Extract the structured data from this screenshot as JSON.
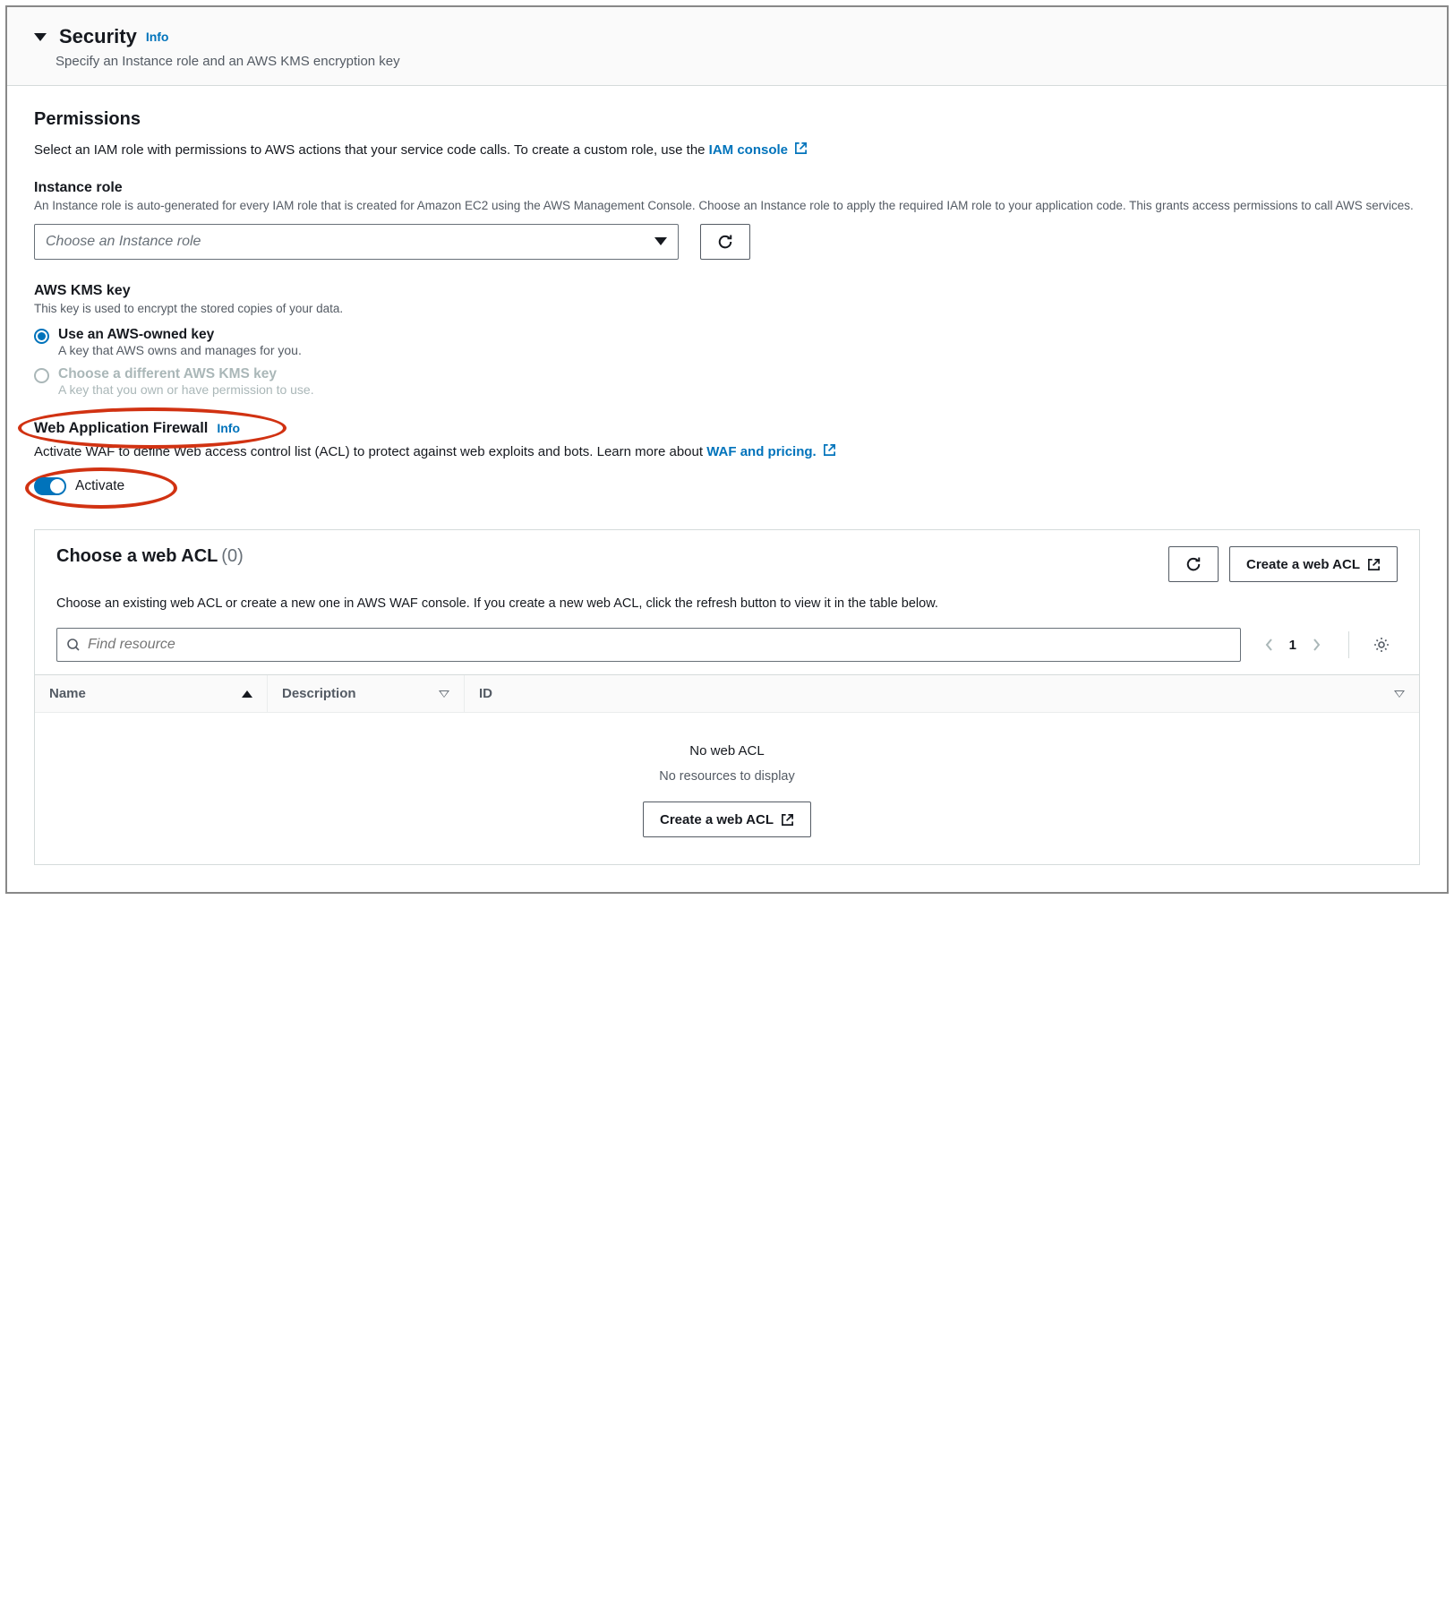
{
  "header": {
    "title": "Security",
    "info": "Info",
    "desc": "Specify an Instance role and an AWS KMS encryption key"
  },
  "permissions": {
    "title": "Permissions",
    "desc": "Select an IAM role with permissions to AWS actions that your service code calls. To create a custom role, use the ",
    "link": "IAM console"
  },
  "instanceRole": {
    "label": "Instance role",
    "help": "An Instance role is auto-generated for every IAM role that is created for Amazon EC2 using the AWS Management Console. Choose an Instance role to apply the required IAM role to your application code. This grants access permissions to call AWS services.",
    "placeholder": "Choose an Instance role"
  },
  "kms": {
    "label": "AWS KMS key",
    "help": "This key is used to encrypt the stored copies of your data.",
    "opt1": {
      "label": "Use an AWS-owned key",
      "sub": "A key that AWS owns and manages for you."
    },
    "opt2": {
      "label": "Choose a different AWS KMS key",
      "sub": "A key that you own or have permission to use."
    }
  },
  "waf": {
    "title": "Web Application Firewall",
    "info": "Info",
    "desc": "Activate WAF to define Web access control list (ACL) to protect against web exploits and bots. Learn more about ",
    "link": "WAF and pricing.",
    "toggle": "Activate"
  },
  "acl": {
    "title": "Choose a web ACL",
    "count": "(0)",
    "createBtn": "Create a web ACL",
    "desc": "Choose an existing web ACL or create a new one in AWS WAF console. If you create a new web ACL, click the refresh button to view it in the table below.",
    "searchPlaceholder": "Find resource",
    "page": "1",
    "cols": {
      "name": "Name",
      "desc": "Description",
      "id": "ID"
    },
    "empty1": "No web ACL",
    "empty2": "No resources to display",
    "emptyBtn": "Create a web ACL"
  }
}
